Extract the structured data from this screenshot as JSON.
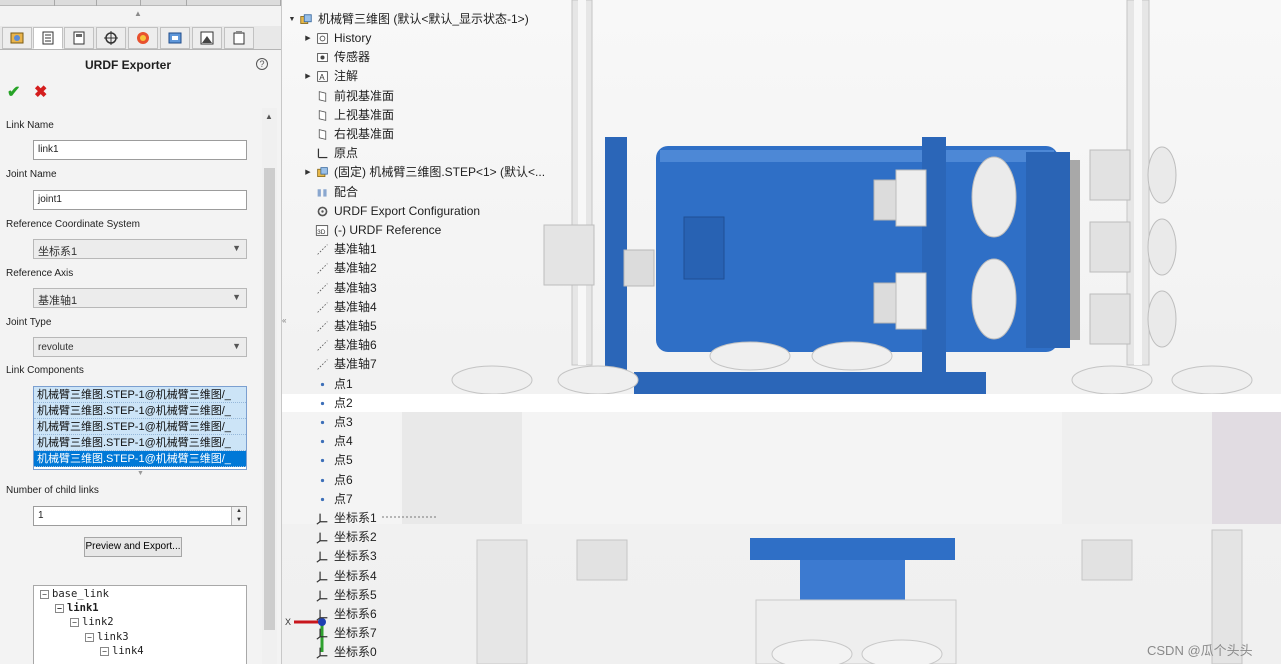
{
  "property_manager": {
    "title": "URDF Exporter",
    "help": "?",
    "ok": "✔",
    "cancel": "✖",
    "link_name_label": "Link Name",
    "link_name_value": "link1",
    "joint_name_label": "Joint Name",
    "joint_name_value": "joint1",
    "ref_coord_label": "Reference Coordinate System",
    "ref_coord_value": "坐标系1",
    "ref_axis_label": "Reference Axis",
    "ref_axis_value": "基准轴1",
    "joint_type_label": "Joint Type",
    "joint_type_value": "revolute",
    "link_components_label": "Link Components",
    "link_components": [
      "机械臂三维图.STEP-1@机械臂三维图/_",
      "机械臂三维图.STEP-1@机械臂三维图/_",
      "机械臂三维图.STEP-1@机械臂三维图/_",
      "机械臂三维图.STEP-1@机械臂三维图/_",
      "机械臂三维图.STEP-1@机械臂三维图/_"
    ],
    "child_links_label": "Number of child links",
    "child_links_value": "1",
    "preview_button": "Preview and Export...",
    "link_tree": [
      "base_link",
      "link1",
      "link2",
      "link3",
      "link4"
    ]
  },
  "feature_tree": {
    "root": "机械臂三维图 (默认<默认_显示状态-1>)",
    "items": [
      "History",
      "传感器",
      "注解",
      "前视基准面",
      "上视基准面",
      "右视基准面",
      "原点",
      "(固定) 机械臂三维图.STEP<1> (默认<...",
      "配合",
      "URDF Export Configuration",
      "(-) URDF Reference",
      "基准轴1",
      "基准轴2",
      "基准轴3",
      "基准轴4",
      "基准轴5",
      "基准轴6",
      "基准轴7",
      "点1",
      "点2",
      "点3",
      "点4",
      "点5",
      "点6",
      "点7",
      "坐标系1",
      "坐标系2",
      "坐标系3",
      "坐标系4",
      "坐标系5",
      "坐标系6",
      "坐标系7",
      "坐标系0"
    ]
  },
  "viewport": {
    "triad_x": "X",
    "watermark": "CSDN @瓜个头头"
  },
  "colors": {
    "servo_blue": "#2f6fc6",
    "selection_blue": "#0078d7",
    "ok_green": "#27a327",
    "cancel_red": "#d41d1d"
  }
}
